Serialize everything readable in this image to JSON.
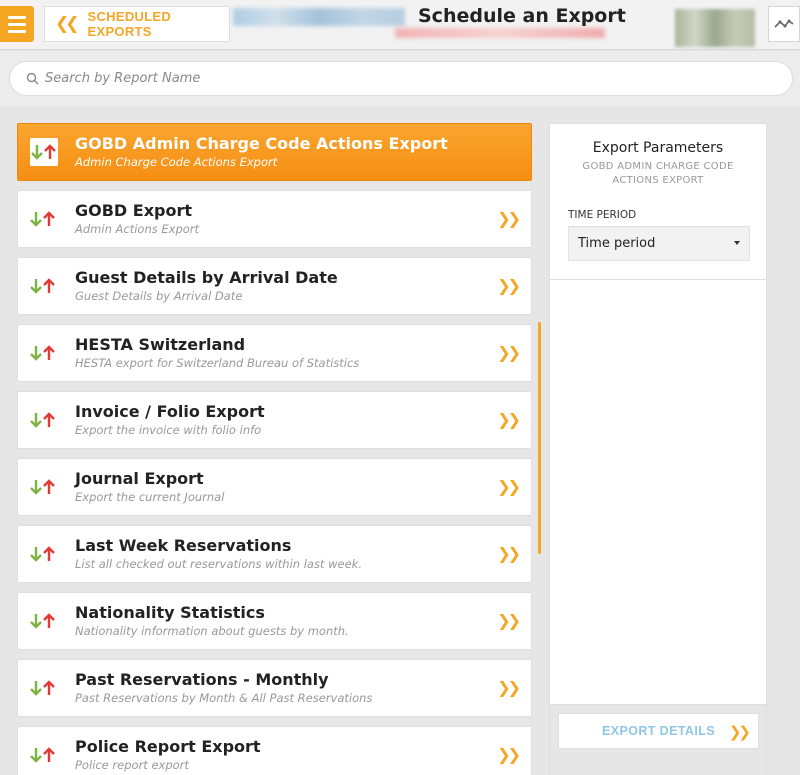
{
  "header": {
    "back_label": "SCHEDULED EXPORTS",
    "title": "Schedule an Export"
  },
  "search": {
    "placeholder": "Search by Report Name"
  },
  "reports": [
    {
      "title": "GOBD Admin Charge Code Actions Export",
      "subtitle": "Admin Charge Code Actions Export",
      "active": true
    },
    {
      "title": "GOBD Export",
      "subtitle": "Admin Actions Export"
    },
    {
      "title": "Guest Details by Arrival Date",
      "subtitle": "Guest Details by Arrival Date"
    },
    {
      "title": "HESTA Switzerland",
      "subtitle": "HESTA export for Switzerland Bureau of Statistics"
    },
    {
      "title": "Invoice / Folio Export",
      "subtitle": "Export the invoice with folio info"
    },
    {
      "title": "Journal Export",
      "subtitle": "Export the current Journal"
    },
    {
      "title": "Last Week Reservations",
      "subtitle": "List all checked out reservations within last week."
    },
    {
      "title": "Nationality Statistics",
      "subtitle": "Nationality information about guests by month."
    },
    {
      "title": "Past Reservations - Monthly",
      "subtitle": "Past Reservations by Month & All Past Reservations"
    },
    {
      "title": "Police Report Export",
      "subtitle": "Police report export"
    }
  ],
  "panel": {
    "title": "Export Parameters",
    "subtitle": "GOBD ADMIN CHARGE CODE ACTIONS EXPORT",
    "field_label": "TIME PERIOD",
    "select_value": "Time period",
    "details_button": "EXPORT DETAILS"
  },
  "colors": {
    "accent": "#f5a623",
    "down_arrow": "#7cb342",
    "up_arrow": "#e53935",
    "link": "#8ec7e6"
  }
}
